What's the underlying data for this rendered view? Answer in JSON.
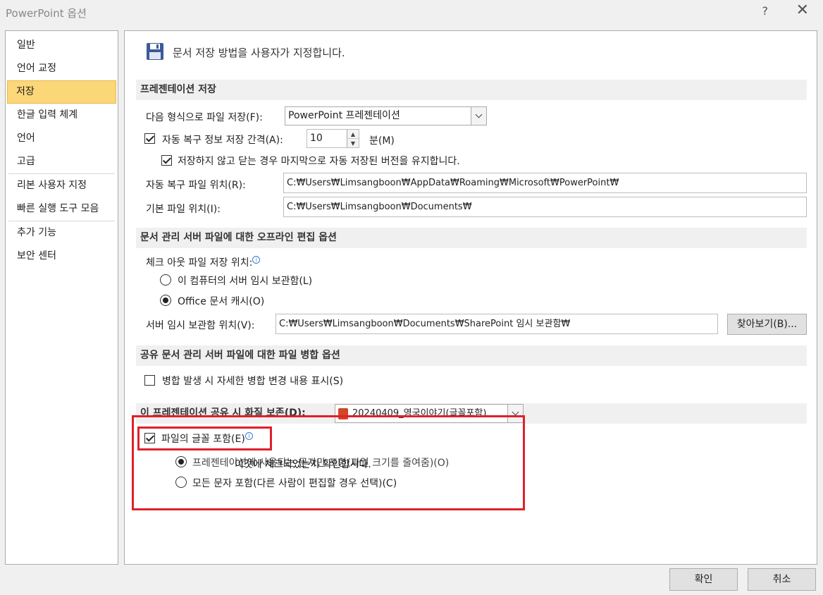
{
  "window": {
    "title": "PowerPoint 옵션",
    "help": "?",
    "close": "✕"
  },
  "sidebar": {
    "items": [
      {
        "label": "일반"
      },
      {
        "label": "언어 교정"
      },
      {
        "label": "저장",
        "selected": true
      },
      {
        "label": "한글 입력 체계"
      },
      {
        "label": "언어"
      },
      {
        "label": "고급"
      },
      {
        "label": "리본 사용자 지정"
      },
      {
        "label": "빠른 실행 도구 모음"
      },
      {
        "label": "추가 기능"
      },
      {
        "label": "보안 센터"
      }
    ]
  },
  "main": {
    "heading": "문서 저장 방법을 사용자가 지정합니다.",
    "sec1": {
      "title": "프레젠테이션 저장",
      "format_label": "다음 형식으로 파일 저장(F):",
      "format_value": "PowerPoint 프레젠테이션",
      "autorecover_label": "자동 복구 정보 저장 간격(A):",
      "autorecover_value": "10",
      "minutes_label": "분(M)",
      "keep_last_label": "저장하지 않고 닫는 경우 마지막으로 자동 저장된 버전을 유지합니다.",
      "autorecover_loc_label": "자동 복구 파일 위치(R):",
      "autorecover_loc_value": "C:₩Users₩Limsangboon₩AppData₩Roaming₩Microsoft₩PowerPoint₩",
      "default_loc_label": "기본 파일 위치(I):",
      "default_loc_value": "C:₩Users₩Limsangboon₩Documents₩"
    },
    "sec2": {
      "title": "문서 관리 서버 파일에 대한 오프라인 편집 옵션",
      "checkout_label": "체크 아웃 파일 저장 위치:",
      "opt_server": "이 컴퓨터의 서버 임시 보관함(L)",
      "opt_office": "Office 문서 캐시(O)",
      "drafts_label": "서버 임시 보관함 위치(V):",
      "drafts_value": "C:₩Users₩Limsangboon₩Documents₩SharePoint 임시 보관함₩",
      "browse": "찾아보기(B)..."
    },
    "sec3": {
      "title": "공유 문서 관리 서버 파일에 대한 파일 병합 옵션",
      "merge_label": "병합 발생 시 자세한 병합 변경 내용 표시(S)"
    },
    "sec4": {
      "title": "이 프레젠테이션 공유 시 화질 보존(D):",
      "file_value": "20240409_영국이야기(글꼴포함)",
      "embed_label": "파일의 글꼴 포함(E)",
      "opt_used": "프레젠테이션에 사용되는 문자만 포함(파일 크기를 줄여줌)(O)",
      "opt_used_overlay": "이것에 체크되었는지 확인합시다.",
      "opt_all": "모든 문자 포함(다른 사람이 편집할 경우 선택)(C)"
    }
  },
  "footer": {
    "ok": "확인",
    "cancel": "취소"
  },
  "colors": {
    "selected_bg": "#fcd778",
    "highlight_box": "#e0202a",
    "section_bg": "#f0f0f0"
  }
}
